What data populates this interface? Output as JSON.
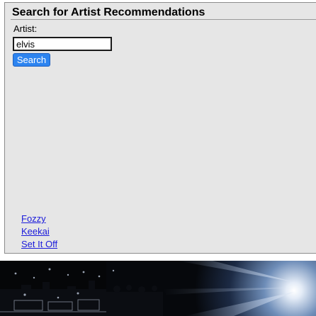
{
  "panel": {
    "title": "Search for Artist Recommendations"
  },
  "search": {
    "label": "Artist:",
    "value": "elvis",
    "button_label": "Search"
  },
  "results": [
    {
      "label": "Fozzy"
    },
    {
      "label": "Keekai"
    },
    {
      "label": "Set It Off"
    }
  ],
  "hero": {
    "description_icon": "concert-photo"
  }
}
